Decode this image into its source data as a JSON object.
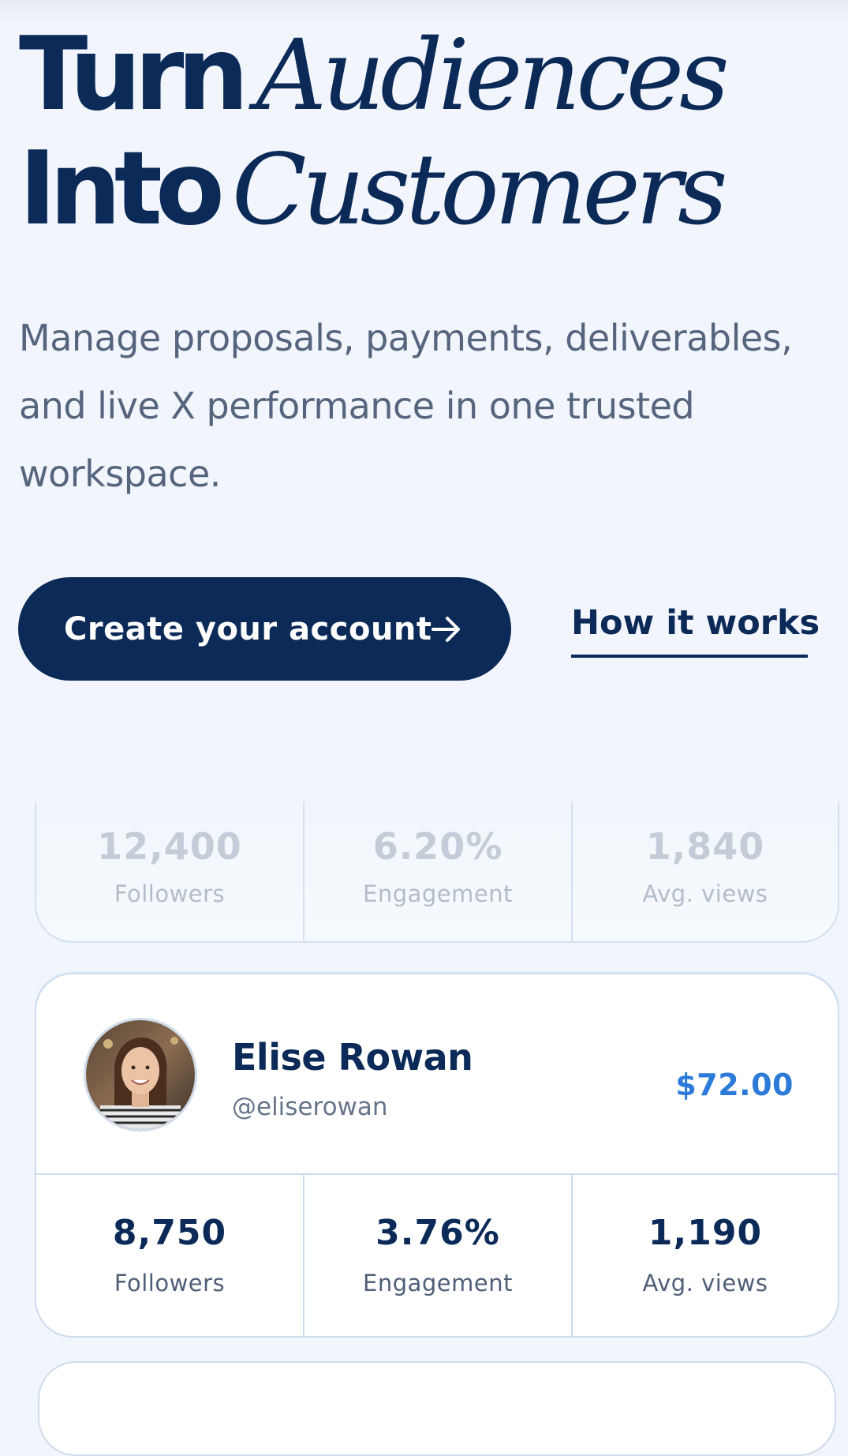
{
  "hero": {
    "title_line1_bold": "Turn",
    "title_line1_italic": "Audiences",
    "title_line2_bold": "Into",
    "title_line2_italic": "Customers",
    "subtitle": "Manage proposals, payments, deliverables, and live X performance in one trusted workspace."
  },
  "cta": {
    "primary_label": "Create your account",
    "primary_icon": "arrow-right-icon",
    "secondary_label": "How it works"
  },
  "summary_stats": [
    {
      "value": "12,400",
      "label": "Followers"
    },
    {
      "value": "6.20%",
      "label": "Engagement"
    },
    {
      "value": "1,840",
      "label": "Avg. views"
    }
  ],
  "profile": {
    "name": "Elise Rowan",
    "handle": "@eliserowan",
    "price": "$72.00",
    "stats": [
      {
        "value": "8,750",
        "label": "Followers"
      },
      {
        "value": "3.76%",
        "label": "Engagement"
      },
      {
        "value": "1,190",
        "label": "Avg. views"
      }
    ]
  },
  "colors": {
    "background": "#f2f6fc",
    "navy": "#0b2a58",
    "accent_blue": "#2c7bd8",
    "muted_text": "#55657e",
    "card_border": "#cddcee"
  }
}
